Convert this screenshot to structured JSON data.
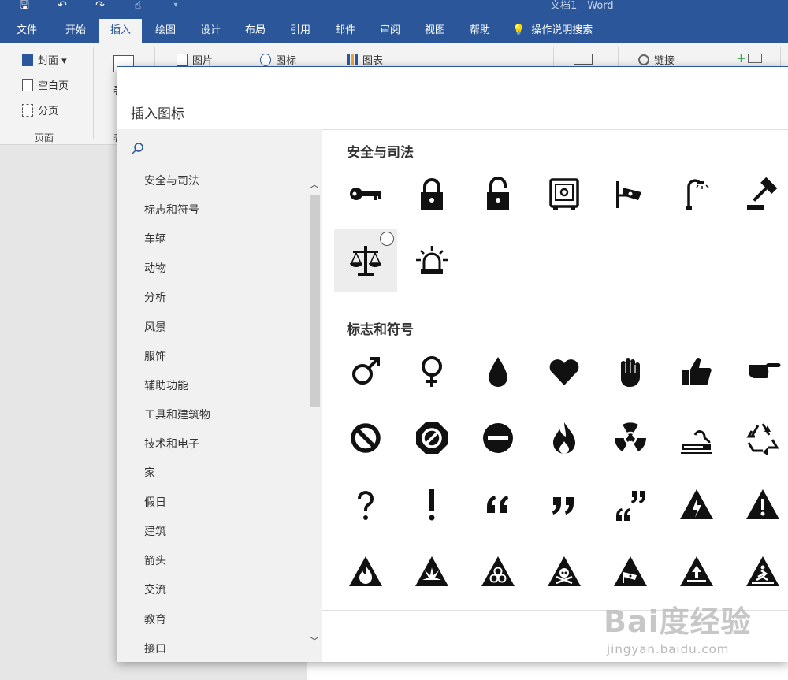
{
  "window": {
    "title": "文档1  -  Word"
  },
  "quick_access": [
    {
      "name": "save",
      "glyph": "🖫"
    },
    {
      "name": "undo",
      "glyph": "↶"
    },
    {
      "name": "redo",
      "glyph": "↷"
    },
    {
      "name": "touch",
      "glyph": "☝"
    },
    {
      "name": "more",
      "glyph": "▾"
    }
  ],
  "tabs": [
    {
      "label": "文件"
    },
    {
      "label": "开始"
    },
    {
      "label": "插入",
      "active": true
    },
    {
      "label": "绘图"
    },
    {
      "label": "设计"
    },
    {
      "label": "布局"
    },
    {
      "label": "引用"
    },
    {
      "label": "邮件"
    },
    {
      "label": "审阅"
    },
    {
      "label": "视图"
    },
    {
      "label": "帮助"
    },
    {
      "label": "操作说明搜索"
    }
  ],
  "ribbon": {
    "pages_group": {
      "cover": "封面 ▾",
      "blank": "空白页",
      "break": "分页",
      "label": "页面"
    },
    "table_partial": "表",
    "table_label_partial": "表",
    "pictures": "图片",
    "icons": "图标",
    "chart": "图表",
    "link": "链接"
  },
  "dialog": {
    "title": "插入图标",
    "search": {
      "placeholder": "",
      "value": ""
    },
    "categories": [
      "安全与司法",
      "标志和符号",
      "车辆",
      "动物",
      "分析",
      "风景",
      "服饰",
      "辅助功能",
      "工具和建筑物",
      "技术和电子",
      "家",
      "假日",
      "建筑",
      "箭头",
      "交流",
      "教育",
      "接口"
    ],
    "sections": [
      {
        "title": "安全与司法",
        "icons": [
          "key-icon",
          "lock-icon",
          "unlock-icon",
          "safe-icon",
          "security-camera-icon",
          "street-light-icon",
          "gavel-icon",
          "scales-of-justice-icon",
          "siren-icon"
        ]
      },
      {
        "title": "标志和符号",
        "icons": [
          "male-icon",
          "female-icon",
          "drop-icon",
          "heart-icon",
          "hand-icon",
          "thumbs-up-icon",
          "point-right-icon",
          "prohibited-icon",
          "stop-icon",
          "minus-circle-icon",
          "fire-icon",
          "radioactive-icon",
          "no-smoking-icon",
          "recycle-icon",
          "question-icon",
          "exclamation-icon",
          "open-quote-icon",
          "close-quote-icon",
          "quotes-icon",
          "warning-icon",
          "warning-icon-2",
          "flammable-warning-icon",
          "explosive-warning-icon",
          "biohazard-warning-icon",
          "toxic-warning-icon",
          "camera-warning-icon",
          "hot-surface-warning-icon",
          "slippery-warning-icon"
        ]
      }
    ]
  },
  "watermark": {
    "text": "Bai度经验",
    "sub": "jingyan.baidu.com"
  }
}
